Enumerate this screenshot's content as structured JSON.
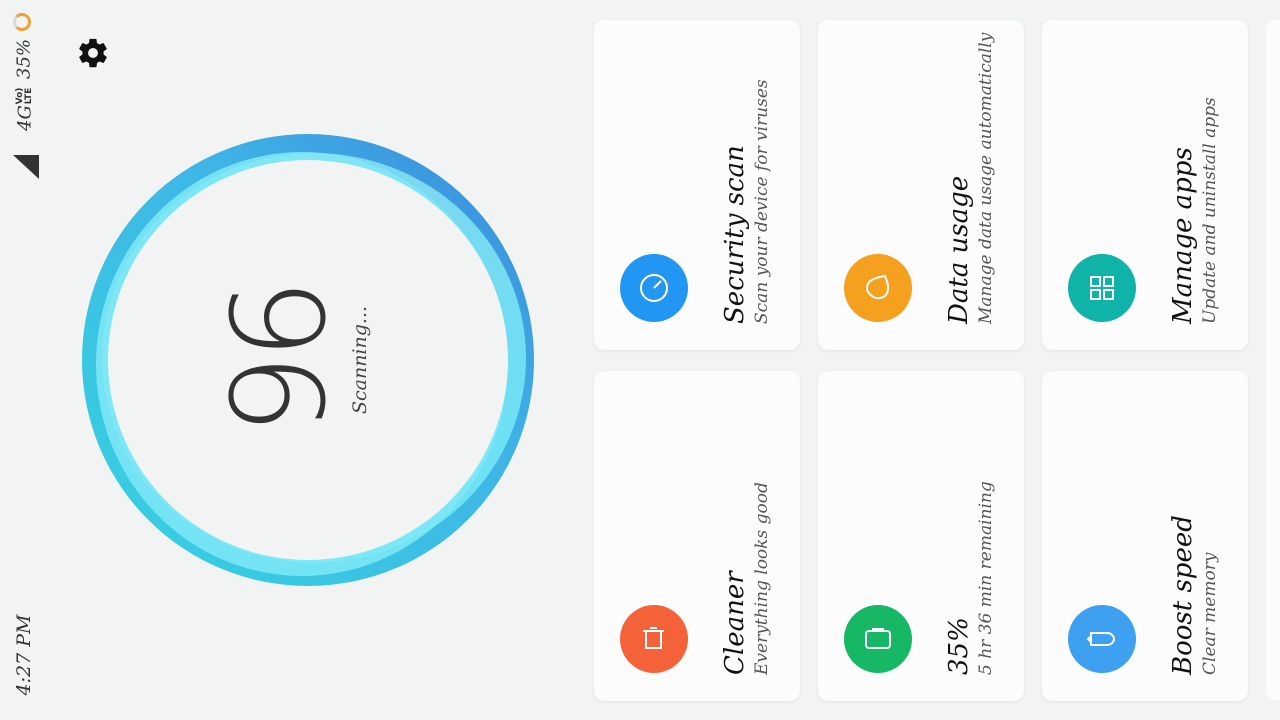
{
  "status": {
    "time": "4:27 PM",
    "network": "4G",
    "volte_top": "Vo)",
    "volte_bottom": "LTE",
    "battery": "35%"
  },
  "header": {
    "settings_icon": "gear-icon"
  },
  "gauge": {
    "score": "96",
    "label": "Scanning..."
  },
  "cards": [
    {
      "title": "Security scan",
      "subtitle": "Scan your device for viruses",
      "icon": "gauge-icon",
      "color": "#2196f3"
    },
    {
      "title": "Data usage",
      "subtitle": "Manage data usage automatically",
      "icon": "drop-icon",
      "color": "#f5a01e"
    },
    {
      "title": "Manage apps",
      "subtitle": "Update and uninstall apps",
      "icon": "grid-icon",
      "color": "#0fb3a8"
    },
    {
      "title": "Cleaner",
      "subtitle": "Everything looks good",
      "icon": "trash-icon",
      "color": "#f4623a"
    },
    {
      "title": "35%",
      "subtitle": "5 hr 36 min  remaining",
      "icon": "battery-icon",
      "color": "#16b865"
    },
    {
      "title": "Boost speed",
      "subtitle": "Clear memory",
      "icon": "rocket-icon",
      "color": "#3ea0f0"
    }
  ]
}
